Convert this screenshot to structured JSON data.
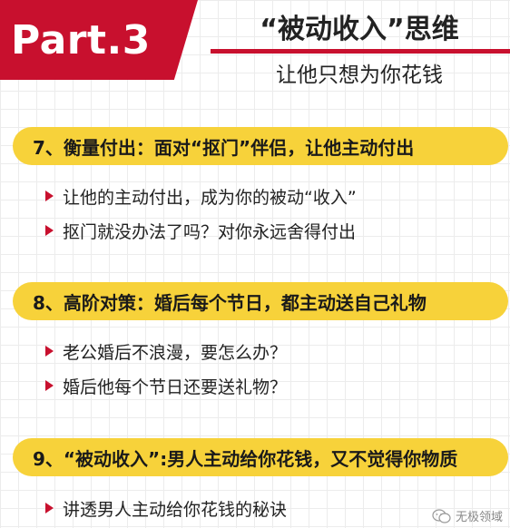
{
  "header": {
    "part_label": "Part.3",
    "title": "“被动收入”思维",
    "subtitle": "让他只想为你花钱"
  },
  "sections": [
    {
      "title": "7、衡量付出：面对“抠门”伴侣，让他主动付出",
      "items": [
        "让他的主动付出，成为你的被动“收入”",
        "抠门就没办法了吗？对你永远舍得付出"
      ]
    },
    {
      "title": "8、高阶对策：婚后每个节日，都主动送自己礼物",
      "items": [
        "老公婚后不浪漫，要怎么办？",
        "婚后他每个节日还要送礼物？"
      ]
    },
    {
      "title": "9、“被动收入”:男人主动给你花钱，又不觉得你物质",
      "items": [
        "讲透男人主动给你花钱的秘诀"
      ]
    }
  ],
  "watermark": {
    "text": "无极领域",
    "icon": "wechat-icon"
  },
  "colors": {
    "accent_red": "#c8102e",
    "pill_yellow": "#f7d23a"
  }
}
